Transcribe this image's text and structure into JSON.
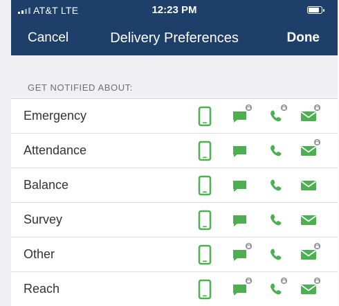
{
  "status_bar": {
    "carrier": "AT&T  LTE",
    "time": "12:23 PM"
  },
  "nav": {
    "cancel_label": "Cancel",
    "title": "Delivery Preferences",
    "done_label": "Done"
  },
  "section_header": "GET NOTIFIED ABOUT:",
  "channel_icons": [
    "phone-push-icon",
    "message-icon",
    "phone-call-icon",
    "email-icon"
  ],
  "colors": {
    "accent_green": "#4caf50",
    "nav_blue": "#1f3f6b",
    "lock_gray": "#8e8e93"
  },
  "rows": [
    {
      "label": "Emergency",
      "sms_locked": true,
      "call_locked": true,
      "email_locked": true
    },
    {
      "label": "Attendance",
      "sms_locked": false,
      "call_locked": false,
      "email_locked": true
    },
    {
      "label": "Balance",
      "sms_locked": false,
      "call_locked": false,
      "email_locked": false
    },
    {
      "label": "Survey",
      "sms_locked": false,
      "call_locked": false,
      "email_locked": false
    },
    {
      "label": "Other",
      "sms_locked": true,
      "call_locked": false,
      "email_locked": true
    },
    {
      "label": "Reach",
      "sms_locked": true,
      "call_locked": true,
      "email_locked": true
    }
  ]
}
